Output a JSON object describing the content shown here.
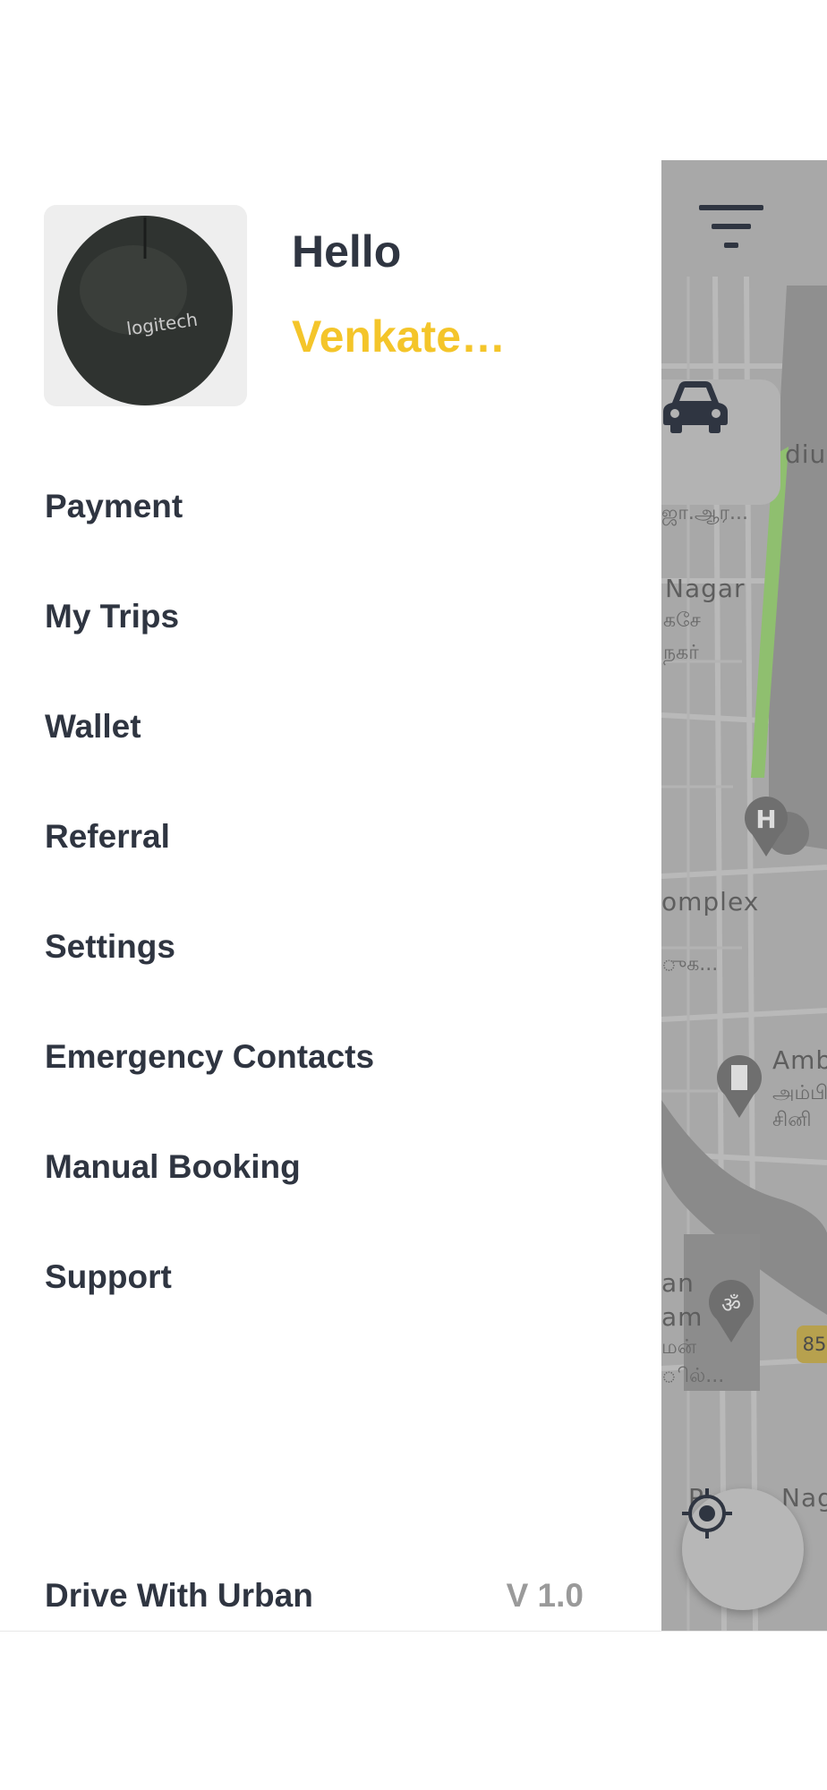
{
  "drawer": {
    "greeting": "Hello",
    "user_name": "Venkate…",
    "menu": [
      {
        "label": "Payment"
      },
      {
        "label": "My Trips"
      },
      {
        "label": "Wallet"
      },
      {
        "label": "Referral"
      },
      {
        "label": "Settings"
      },
      {
        "label": "Emergency Contacts"
      },
      {
        "label": "Manual Booking"
      },
      {
        "label": "Support"
      }
    ],
    "footer": {
      "drive_label": "Drive With Urban",
      "version": "V 1.0"
    }
  },
  "map": {
    "labels": {
      "stadium": "diur",
      "tamil1": "ஜா.ஆர...",
      "nagar": "Nagar",
      "tamil2": "கசே",
      "tamil3": "நகர்",
      "complex": "omplex",
      "tamil4": "ுக...",
      "amb": "Amb",
      "tamil5": "அம்பி",
      "tamil6": "சினி",
      "an": "an",
      "am": "am",
      "tamil7": "மன்",
      "tamil8": "ில்...",
      "p": "P",
      "nag": "Nag",
      "road_number": "85"
    }
  },
  "colors": {
    "accent": "#f4c52a",
    "text_dark": "#2f3541",
    "text_muted": "#9a9a9a"
  }
}
